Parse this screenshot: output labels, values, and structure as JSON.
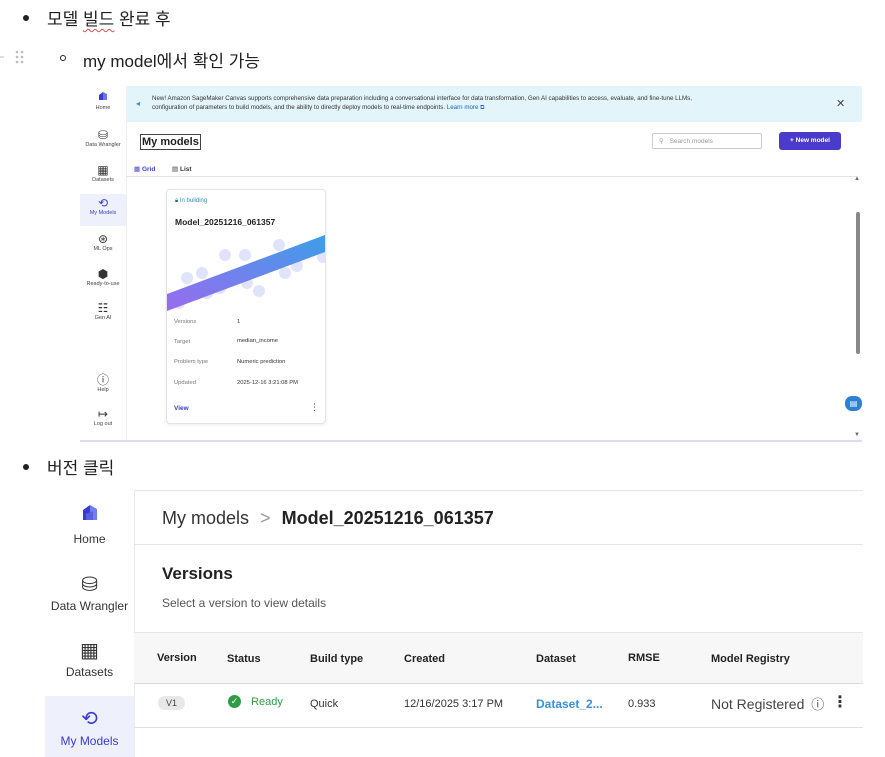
{
  "doc": {
    "bullet1": "모델 빌드 완료 후",
    "bullet1_squiggle": "빌드",
    "bullet1_suffix": " 완료 후",
    "bullet1_prefix": "모델 ",
    "sub_bullet": "my model에서 확인 가능",
    "bullet2": "버전 클릭"
  },
  "shot1": {
    "nav": [
      {
        "label": "Home",
        "icon": "home-icon"
      },
      {
        "label": "Data Wrangler",
        "icon": "data-wrangler-icon"
      },
      {
        "label": "Datasets",
        "icon": "datasets-icon"
      },
      {
        "label": "My Models",
        "icon": "my-models-icon"
      },
      {
        "label": "ML Ops",
        "icon": "ml-ops-icon"
      },
      {
        "label": "Ready-to-use",
        "icon": "ready-to-use-icon"
      },
      {
        "label": "Gen AI",
        "icon": "gen-ai-icon"
      },
      {
        "label": "Help",
        "icon": "help-icon"
      },
      {
        "label": "Log out",
        "icon": "log-out-icon"
      }
    ],
    "banner_line1": "New! Amazon SageMaker Canvas supports comprehensive data preparation including a conversational interface for data transformation, Gen AI capabilities to access, evaluate, and fine-tune LLMs,",
    "banner_line2": "configuration of parameters to build models, and the ability to directly deploy models to real-time endpoints.",
    "banner_link": "Learn more",
    "title": "My models",
    "search_placeholder": "Search models",
    "new_model": "+ New model",
    "view_grid": "Grid",
    "view_list": "List",
    "card": {
      "status": "In building",
      "name": "Model_20251216_061357",
      "rows": [
        {
          "label": "Versions",
          "value": "1"
        },
        {
          "label": "Target",
          "value": "median_income"
        },
        {
          "label": "Problem type",
          "value": "Numeric prediction"
        },
        {
          "label": "Updated",
          "value": "2025-12-16 3:21:08 PM"
        }
      ],
      "view": "View"
    }
  },
  "shot2": {
    "nav": [
      {
        "label": "Home",
        "icon": "home-icon"
      },
      {
        "label": "Data Wrangler",
        "icon": "data-wrangler-icon"
      },
      {
        "label": "Datasets",
        "icon": "datasets-icon"
      },
      {
        "label": "My Models",
        "icon": "my-models-icon"
      }
    ],
    "breadcrumb_root": "My models",
    "breadcrumb_sep": ">",
    "breadcrumb_current": "Model_20251216_061357",
    "section_title": "Versions",
    "section_subtitle": "Select a version to view details",
    "columns": [
      "Version",
      "Status",
      "Build type",
      "Created",
      "Dataset",
      "RMSE",
      "Model Registry"
    ],
    "row": {
      "version": "V1",
      "status": "Ready",
      "build_type": "Quick",
      "created": "12/16/2025 3:17 PM",
      "dataset": "Dataset_2...",
      "rmse": "0.933",
      "registry": "Not Registered"
    }
  },
  "colors": {
    "accent": "#4a3bcd",
    "ready_green": "#2e9e44",
    "link_blue": "#3d8fd6",
    "banner_bg": "#e3f5fb"
  }
}
